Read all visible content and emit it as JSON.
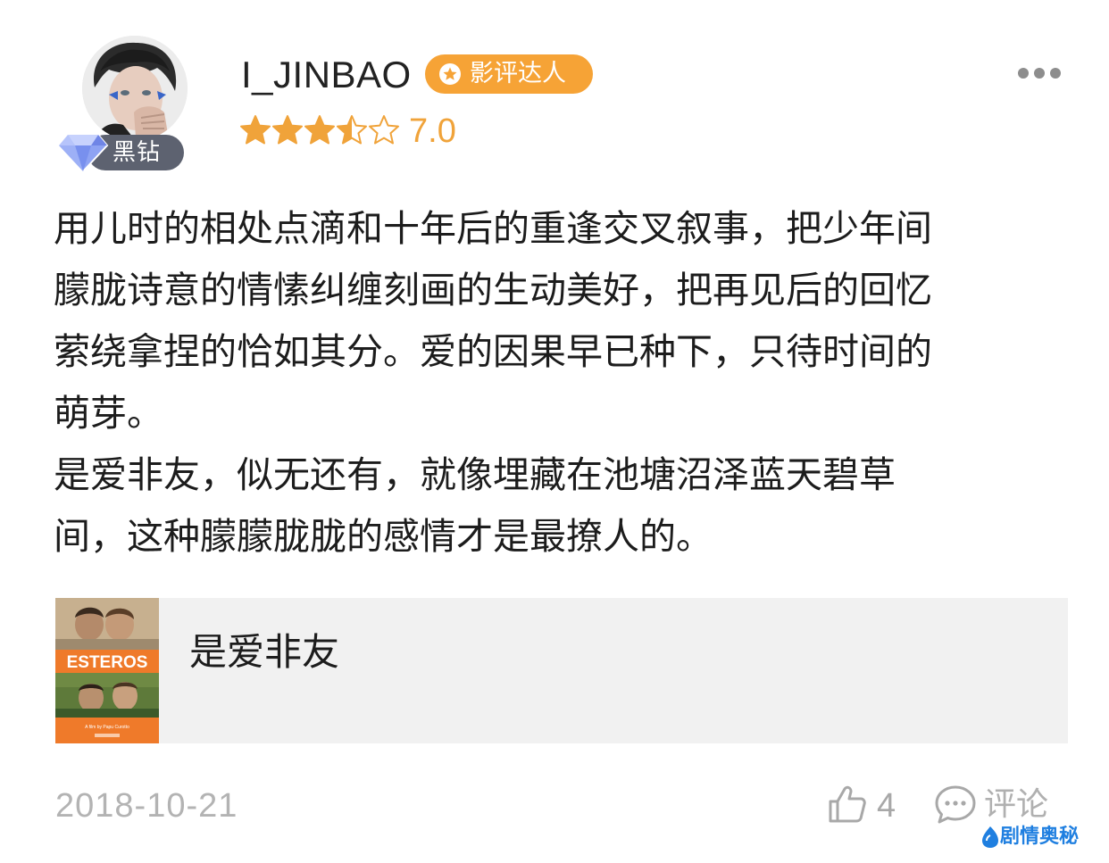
{
  "user": {
    "name": "I_JINBAO",
    "vip_label": "黑钻",
    "critic_tag": "影评达人"
  },
  "rating": {
    "score": "7.0",
    "stars": 3.5,
    "stars_max": 5
  },
  "review": {
    "lines": [
      "用儿时的相处点滴和十年后的重逢交叉叙事，把少年间",
      "朦胧诗意的情愫纠缠刻画的生动美好，把再见后的回忆",
      "萦绕拿捏的恰如其分。爱的因果早已种下，只待时间的",
      "萌芽。",
      "是爱非友，似无还有，就像埋藏在池塘沼泽蓝天碧草",
      "间，这种朦朦胧胧的感情才是最撩人的。"
    ]
  },
  "movie": {
    "title": "是爱非友",
    "poster_title": "ESTEROS",
    "poster_credit": "A film by Papu Curotto"
  },
  "footer": {
    "date": "2018-10-21",
    "like_count": "4",
    "comment_label": "评论"
  },
  "watermark": {
    "text": "剧情奥秘"
  },
  "colors": {
    "accent_orange": "#f6a336",
    "star_color": "#f0a33a",
    "vip_pill": "#5d6270",
    "card_bg": "#f1f1f1",
    "muted_gray": "#b3b3b3",
    "watermark_blue": "#1f7fe0"
  },
  "icons": {
    "more": "more-dots-icon",
    "like": "thumbs-up-icon",
    "comment": "comment-bubble-icon",
    "vip": "diamond-icon",
    "critic": "star-icon"
  }
}
